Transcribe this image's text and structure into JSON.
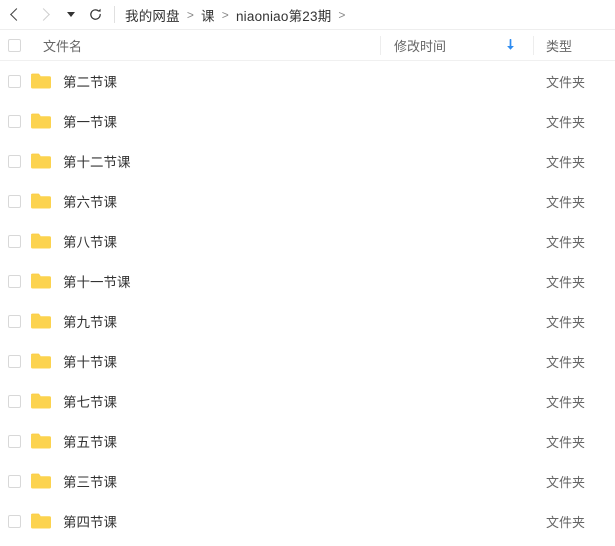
{
  "toolbar": {
    "back_icon": "chevron-left-icon",
    "forward_icon": "chevron-right-icon",
    "dropdown_icon": "caret-down-icon",
    "refresh_icon": "refresh-icon"
  },
  "breadcrumb": {
    "separator": ">",
    "items": [
      {
        "label": "我的网盘"
      },
      {
        "label": "课"
      },
      {
        "label": "niaoniao第23期"
      }
    ],
    "trailing_separator": ">"
  },
  "columns": {
    "name": "文件名",
    "modified": "修改时间",
    "type": "类型",
    "sort_icon": "arrow-down-icon",
    "sort_color": "#2e8cf0"
  },
  "colors": {
    "folder": "#fcd34f",
    "folder_tab": "#fbc63f",
    "accent": "#2e8cf0",
    "text": "#333333",
    "muted": "#666666",
    "border": "#eeeeee"
  },
  "rows": [
    {
      "name": "第二节课",
      "modified": "",
      "type": "文件夹"
    },
    {
      "name": "第一节课",
      "modified": "",
      "type": "文件夹"
    },
    {
      "name": "第十二节课",
      "modified": "",
      "type": "文件夹"
    },
    {
      "name": "第六节课",
      "modified": "",
      "type": "文件夹"
    },
    {
      "name": "第八节课",
      "modified": "",
      "type": "文件夹"
    },
    {
      "name": "第十一节课",
      "modified": "",
      "type": "文件夹"
    },
    {
      "name": "第九节课",
      "modified": "",
      "type": "文件夹"
    },
    {
      "name": "第十节课",
      "modified": "",
      "type": "文件夹"
    },
    {
      "name": "第七节课",
      "modified": "",
      "type": "文件夹"
    },
    {
      "name": "第五节课",
      "modified": "",
      "type": "文件夹"
    },
    {
      "name": "第三节课",
      "modified": "",
      "type": "文件夹"
    },
    {
      "name": "第四节课",
      "modified": "",
      "type": "文件夹"
    }
  ]
}
